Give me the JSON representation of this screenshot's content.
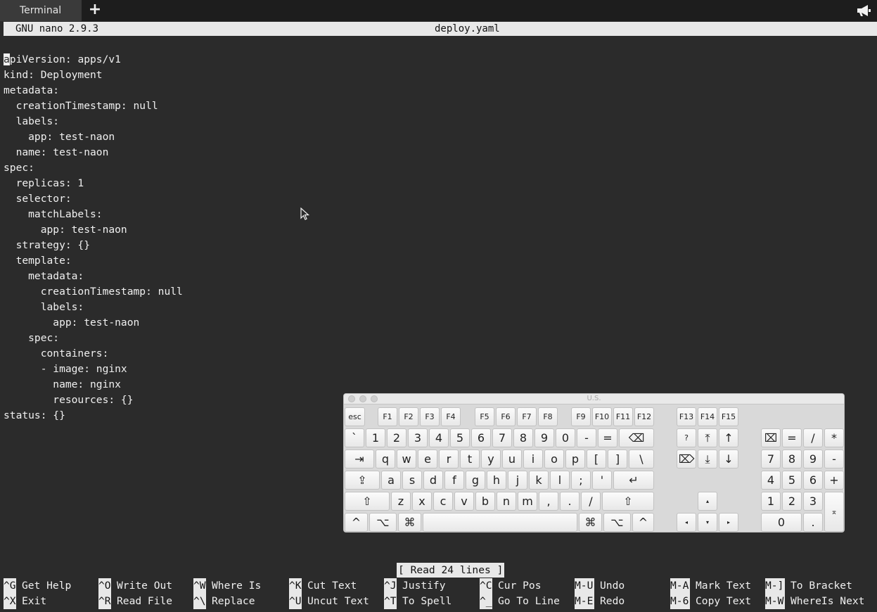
{
  "tabbar": {
    "tab_label": "Terminal",
    "add_label": "+"
  },
  "nano": {
    "version": "GNU nano 2.9.3",
    "filename": "deploy.yaml",
    "status": "[ Read 24 lines ]"
  },
  "editor": {
    "cursor_char": "a",
    "first_rest": "piVersion: apps/v1",
    "lines": [
      "kind: Deployment",
      "metadata:",
      "  creationTimestamp: null",
      "  labels:",
      "    app: test-naon",
      "  name: test-naon",
      "spec:",
      "  replicas: 1",
      "  selector:",
      "    matchLabels:",
      "      app: test-naon",
      "  strategy: {}",
      "  template:",
      "    metadata:",
      "      creationTimestamp: null",
      "      labels:",
      "        app: test-naon",
      "    spec:",
      "      containers:",
      "      - image: nginx",
      "        name: nginx",
      "        resources: {}",
      "status: {}"
    ]
  },
  "shortcuts": [
    {
      "key": "^G",
      "label": "Get Help"
    },
    {
      "key": "^O",
      "label": "Write Out"
    },
    {
      "key": "^W",
      "label": "Where Is"
    },
    {
      "key": "^K",
      "label": "Cut Text"
    },
    {
      "key": "^J",
      "label": "Justify"
    },
    {
      "key": "^C",
      "label": "Cur Pos"
    },
    {
      "key": "M-U",
      "label": "Undo"
    },
    {
      "key": "M-A",
      "label": "Mark Text"
    },
    {
      "key": "M-]",
      "label": "To Bracket"
    },
    {
      "key": "^X",
      "label": "Exit"
    },
    {
      "key": "^R",
      "label": "Read File"
    },
    {
      "key": "^\\",
      "label": "Replace"
    },
    {
      "key": "^U",
      "label": "Uncut Text"
    },
    {
      "key": "^T",
      "label": "To Spell"
    },
    {
      "key": "^_",
      "label": "Go To Line"
    },
    {
      "key": "M-E",
      "label": "Redo"
    },
    {
      "key": "M-6",
      "label": "Copy Text"
    },
    {
      "key": "M-W",
      "label": "WhereIs Next"
    }
  ],
  "keyboard": {
    "title": "U.S.",
    "esc": "esc",
    "fkeys": [
      "F1",
      "F2",
      "F3",
      "F4",
      "F5",
      "F6",
      "F7",
      "F8",
      "F9",
      "F10",
      "F11",
      "F12",
      "F13",
      "F14",
      "F15"
    ],
    "num_row": [
      "`",
      "1",
      "2",
      "3",
      "4",
      "5",
      "6",
      "7",
      "8",
      "9",
      "0",
      "-",
      "="
    ],
    "backspace": "⌫",
    "tab": "⇥",
    "q_row": [
      "q",
      "w",
      "e",
      "r",
      "t",
      "y",
      "u",
      "i",
      "o",
      "p",
      "[",
      "]",
      "\\"
    ],
    "caps": "⇪",
    "a_row": [
      "a",
      "s",
      "d",
      "f",
      "g",
      "h",
      "j",
      "k",
      "l",
      ";",
      "'"
    ],
    "enter": "↵",
    "shift": "⇧",
    "z_row": [
      "z",
      "x",
      "c",
      "v",
      "b",
      "n",
      "m",
      ",",
      ".",
      "/"
    ],
    "control": "^",
    "option": "⌥",
    "command": "⌘",
    "nav_row1": [
      "?",
      "⤒",
      "↑"
    ],
    "nav_row2": [
      "⌦",
      "⤓",
      "↓"
    ],
    "arrow_up": "▴",
    "arrows_bottom": [
      "◂",
      "▾",
      "▸"
    ],
    "numpad_row1": [
      "⌧",
      "=",
      "/",
      "*"
    ],
    "numpad_row2": [
      "7",
      "8",
      "9",
      "-"
    ],
    "numpad_row3": [
      "4",
      "5",
      "6",
      "+"
    ],
    "numpad_row4": [
      "1",
      "2",
      "3"
    ],
    "numpad_zero": "0",
    "numpad_dot": ".",
    "numpad_enter": "⌅"
  }
}
